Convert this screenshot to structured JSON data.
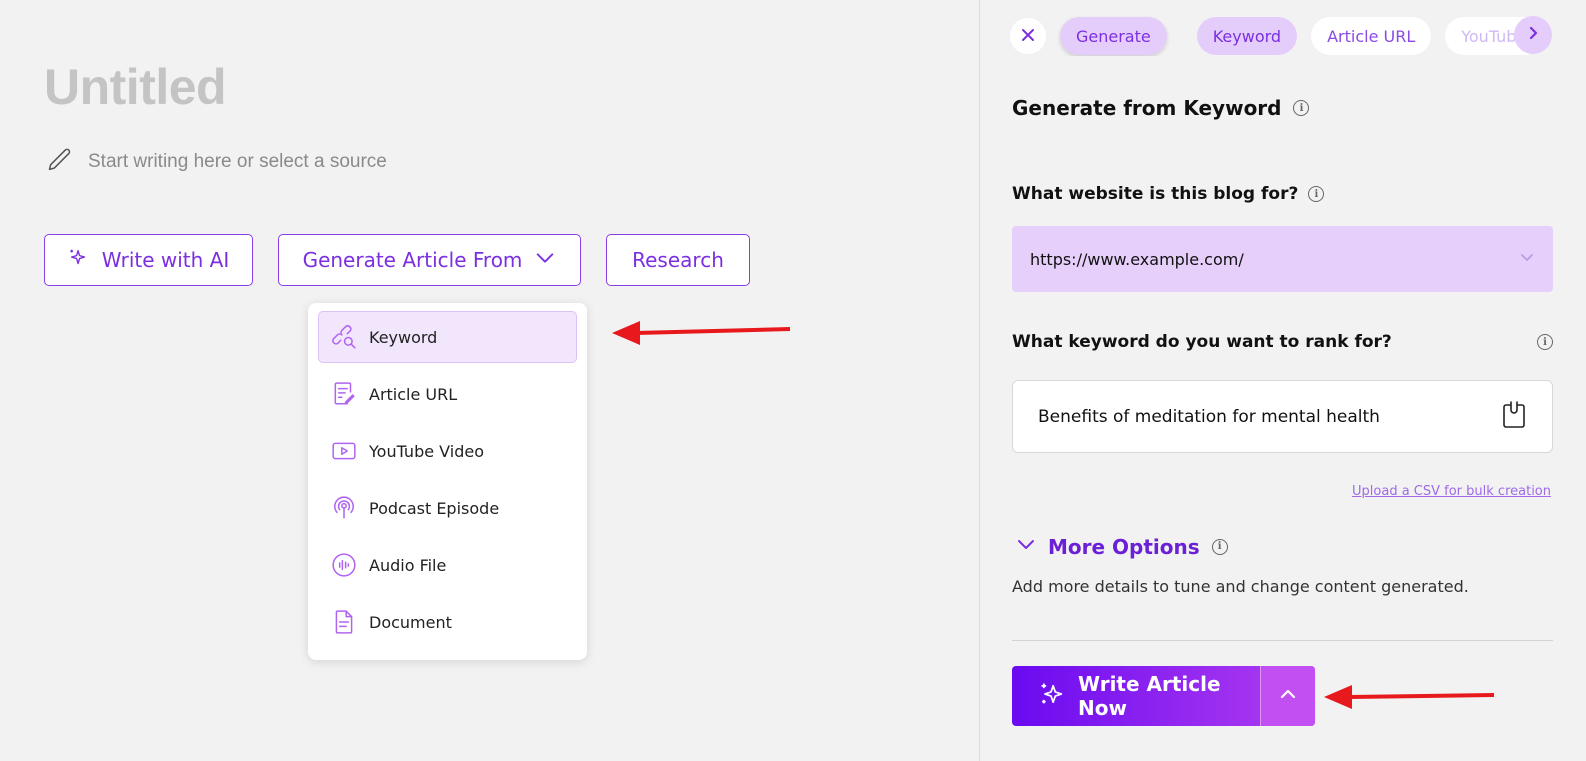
{
  "editor": {
    "title": "Untitled",
    "placeholder": "Start writing here or select a source",
    "buttons": {
      "write_ai": "Write with AI",
      "generate_from": "Generate Article From",
      "research": "Research"
    },
    "dropdown": {
      "items": [
        {
          "label": "Keyword",
          "icon": "keyword-icon",
          "active": true
        },
        {
          "label": "Article URL",
          "icon": "article-icon"
        },
        {
          "label": "YouTube Video",
          "icon": "youtube-icon"
        },
        {
          "label": "Podcast Episode",
          "icon": "podcast-icon"
        },
        {
          "label": "Audio File",
          "icon": "audio-icon"
        },
        {
          "label": "Document",
          "icon": "document-icon"
        }
      ]
    }
  },
  "panel": {
    "tabs": [
      "Generate",
      "Keyword",
      "Article URL",
      "YouTube"
    ],
    "heading": "Generate from Keyword",
    "website_label": "What website is this blog for?",
    "website_value": "https://www.example.com/",
    "keyword_label": "What keyword do you want to rank for?",
    "keyword_value": "Benefits of meditation for mental health",
    "csv_link": "Upload a CSV for bulk creation",
    "more_options": "More Options",
    "more_desc": "Add more details to tune and change content generated.",
    "cta": "Write Article Now"
  },
  "colors": {
    "accent": "#7b2fe0",
    "accent_light": "#e5cdfb",
    "arrow": "#e8191c"
  }
}
